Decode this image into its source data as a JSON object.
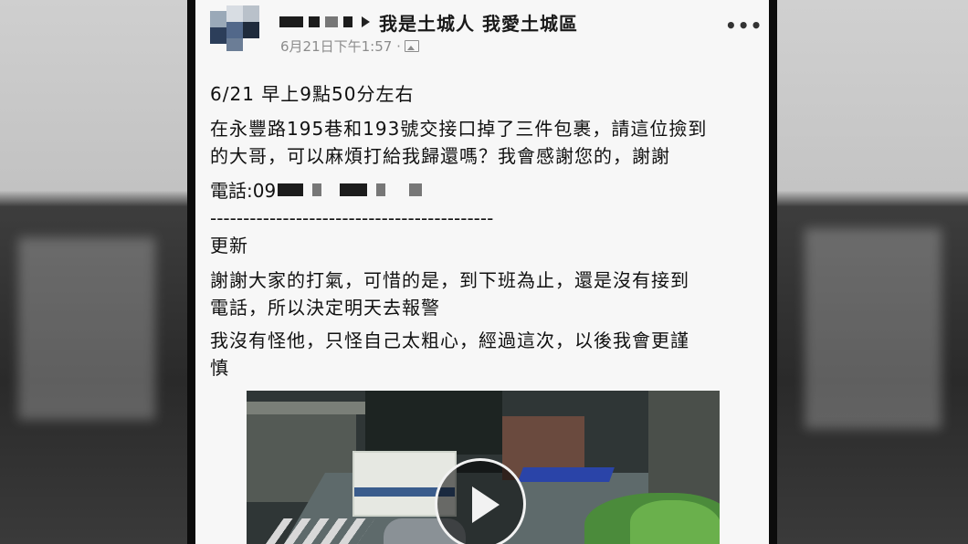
{
  "post": {
    "group_name": "我是土城人 我愛土城區",
    "timestamp": "6月21日下午1:57 ·",
    "more_label": "•••",
    "lines": [
      "6/21 早上9點50分左右",
      "在永豐路195巷和193號交接口掉了三件包裹，請這位撿到",
      "的大哥，可以麻煩打給我歸還嗎？我會感謝您的，謝謝",
      "-------------------------------------------",
      "更新",
      "謝謝大家的打氣，可惜的是，到下班為止，還是沒有接到",
      "電話，所以決定明天去報警",
      "我沒有怪他，只怪自己太粗心，經過這次，以後我會更謹",
      "慎"
    ],
    "phone_label": "電話:09"
  },
  "icons": {
    "privacy": "audience-icon",
    "play": "play-icon",
    "more": "more-options-icon"
  },
  "colors": {
    "post_bg": "#f7f7f7",
    "text": "#111111",
    "timestamp": "#8c8c8c"
  }
}
